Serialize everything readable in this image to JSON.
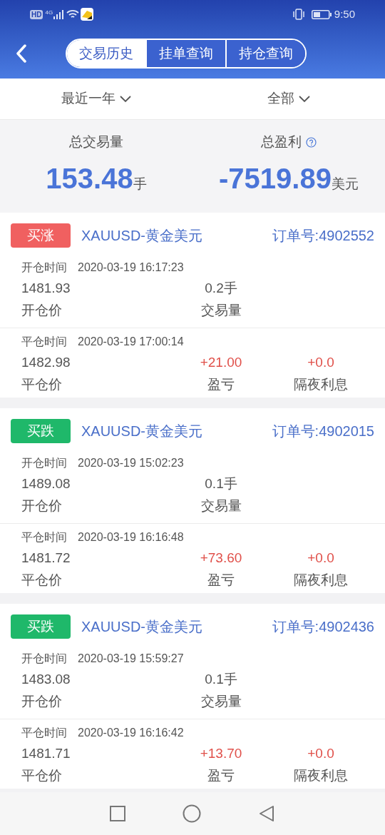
{
  "status_bar": {
    "hd": "HD",
    "network": "4G",
    "time": "9:50"
  },
  "tabs": [
    {
      "label": "交易历史",
      "selected": true
    },
    {
      "label": "挂单查询",
      "selected": false
    },
    {
      "label": "持仓查询",
      "selected": false
    }
  ],
  "filters": [
    {
      "label": "最近一年"
    },
    {
      "label": "全部"
    }
  ],
  "summary": [
    {
      "label": "总交易量",
      "value": "153.48",
      "unit": "手",
      "help": false
    },
    {
      "label": "总盈利",
      "value": "-7519.89",
      "unit": "美元",
      "help": true
    }
  ],
  "orders": [
    {
      "side": {
        "label": "买涨",
        "color": "#f06060"
      },
      "symbol": "XAUUSD-黄金美元",
      "order_no": "订单号:4902552",
      "open_time_label": "开仓时间",
      "open_time": "2020-03-19 16:17:23",
      "open_price": "1481.93",
      "volume": "0.2手",
      "open_price_label": "开仓价",
      "volume_label": "交易量",
      "close_time_label": "平仓时间",
      "close_time": "2020-03-19 17:00:14",
      "close_price": "1482.98",
      "pnl": "+21.00",
      "swap": "+0.0",
      "close_price_label": "平仓价",
      "pnl_label": "盈亏",
      "swap_label": "隔夜利息"
    },
    {
      "side": {
        "label": "买跌",
        "color": "#1fb86a"
      },
      "symbol": "XAUUSD-黄金美元",
      "order_no": "订单号:4902015",
      "open_time_label": "开仓时间",
      "open_time": "2020-03-19 15:02:23",
      "open_price": "1489.08",
      "volume": "0.1手",
      "open_price_label": "开仓价",
      "volume_label": "交易量",
      "close_time_label": "平仓时间",
      "close_time": "2020-03-19 16:16:48",
      "close_price": "1481.72",
      "pnl": "+73.60",
      "swap": "+0.0",
      "close_price_label": "平仓价",
      "pnl_label": "盈亏",
      "swap_label": "隔夜利息"
    },
    {
      "side": {
        "label": "买跌",
        "color": "#1fb86a"
      },
      "symbol": "XAUUSD-黄金美元",
      "order_no": "订单号:4902436",
      "open_time_label": "开仓时间",
      "open_time": "2020-03-19 15:59:27",
      "open_price": "1483.08",
      "volume": "0.1手",
      "open_price_label": "开仓价",
      "volume_label": "交易量",
      "close_time_label": "平仓时间",
      "close_time": "2020-03-19 16:16:42",
      "close_price": "1481.71",
      "pnl": "+13.70",
      "swap": "+0.0",
      "close_price_label": "平仓价",
      "pnl_label": "盈亏",
      "swap_label": "隔夜利息"
    }
  ]
}
